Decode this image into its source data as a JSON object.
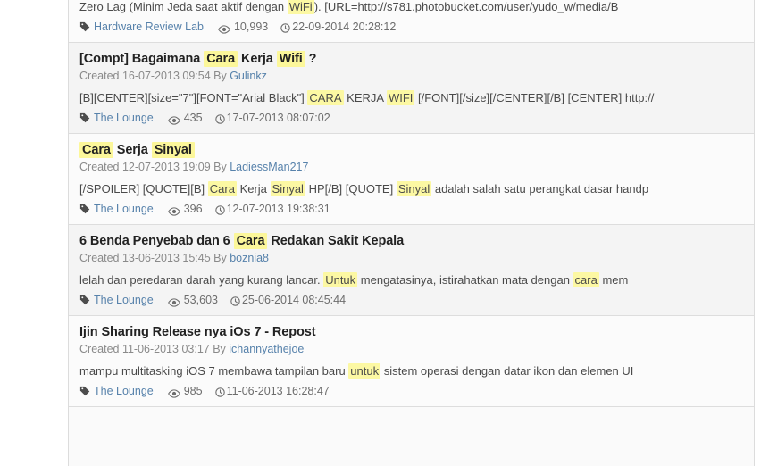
{
  "colors": {
    "highlight": "#fcf8a3",
    "link": "#5782ab",
    "title": "#222222",
    "meta": "#8a8a8a",
    "snippet": "#4a4a4a",
    "panel_bg": "#fbfbfb",
    "panel_bg_alt": "#f4f4f4",
    "divider": "#dddddd"
  },
  "icons": {
    "tag": "tag-icon",
    "views": "eye-icon",
    "date": "clock-icon"
  },
  "labels": {
    "created_prefix": "Created",
    "by": "By"
  },
  "results": [
    {
      "title_parts": [],
      "title_plain": "",
      "created": "",
      "author": "",
      "snippet_parts": [
        {
          "t": "Zero Lag (Minim Jeda saat aktif dengan ",
          "hl": false
        },
        {
          "t": "WiFi",
          "hl": true
        },
        {
          "t": "). [URL=http://s781.photobucket.com/user/yudo_w/media/B",
          "hl": false
        }
      ],
      "forum": "Hardware Review Lab",
      "views": "10,993",
      "date": "22-09-2014 20:28:12"
    },
    {
      "title_parts": [
        {
          "t": "[Compt] Bagaimana ",
          "hl": false
        },
        {
          "t": "Cara",
          "hl": true
        },
        {
          "t": " Kerja ",
          "hl": false
        },
        {
          "t": "Wifi",
          "hl": true
        },
        {
          "t": " ?",
          "hl": false
        }
      ],
      "created": "16-07-2013 09:54",
      "author": "Gulinkz",
      "snippet_parts": [
        {
          "t": "[B][CENTER][size=\"7\"][FONT=\"Arial Black\"] ",
          "hl": false
        },
        {
          "t": "CARA",
          "hl": true
        },
        {
          "t": " KERJA ",
          "hl": false
        },
        {
          "t": "WIFI",
          "hl": true
        },
        {
          "t": " [/FONT][/size][/CENTER][/B] [CENTER] http://",
          "hl": false
        }
      ],
      "forum": "The Lounge",
      "views": "435",
      "date": "17-07-2013 08:07:02"
    },
    {
      "title_parts": [
        {
          "t": "Cara",
          "hl": true
        },
        {
          "t": " Serja ",
          "hl": false
        },
        {
          "t": "Sinyal",
          "hl": true
        }
      ],
      "created": "12-07-2013 19:09",
      "author": "LadiessMan217",
      "snippet_parts": [
        {
          "t": "[/SPOILER] [QUOTE][B] ",
          "hl": false
        },
        {
          "t": "Cara",
          "hl": true
        },
        {
          "t": " Kerja ",
          "hl": false
        },
        {
          "t": "Sinyal",
          "hl": true
        },
        {
          "t": " HP[/B] [QUOTE] ",
          "hl": false
        },
        {
          "t": "Sinyal",
          "hl": true
        },
        {
          "t": " adalah salah satu perangkat dasar handp",
          "hl": false
        }
      ],
      "forum": "The Lounge",
      "views": "396",
      "date": "12-07-2013 19:38:31"
    },
    {
      "title_parts": [
        {
          "t": "6 Benda Penyebab dan 6 ",
          "hl": false
        },
        {
          "t": "Cara",
          "hl": true
        },
        {
          "t": " Redakan Sakit Kepala",
          "hl": false
        }
      ],
      "created": "13-06-2013 15:45",
      "author": "boznia8",
      "snippet_parts": [
        {
          "t": "lelah dan peredaran darah yang kurang lancar. ",
          "hl": false
        },
        {
          "t": "Untuk",
          "hl": true
        },
        {
          "t": " mengatasinya, istirahatkan mata dengan ",
          "hl": false
        },
        {
          "t": "cara",
          "hl": true
        },
        {
          "t": " mem",
          "hl": false
        }
      ],
      "forum": "The Lounge",
      "views": "53,603",
      "date": "25-06-2014 08:45:44"
    },
    {
      "title_parts": [
        {
          "t": "Ijin Sharing Release nya iOs 7 - Repost",
          "hl": false
        }
      ],
      "created": "11-06-2013 03:17",
      "author": "ichannyathejoe",
      "snippet_parts": [
        {
          "t": "mampu multitasking iOS 7 membawa tampilan baru ",
          "hl": false
        },
        {
          "t": "untuk",
          "hl": true
        },
        {
          "t": " sistem operasi dengan datar ikon dan elemen UI",
          "hl": false
        }
      ],
      "forum": "The Lounge",
      "views": "985",
      "date": "11-06-2013 16:28:47"
    }
  ]
}
